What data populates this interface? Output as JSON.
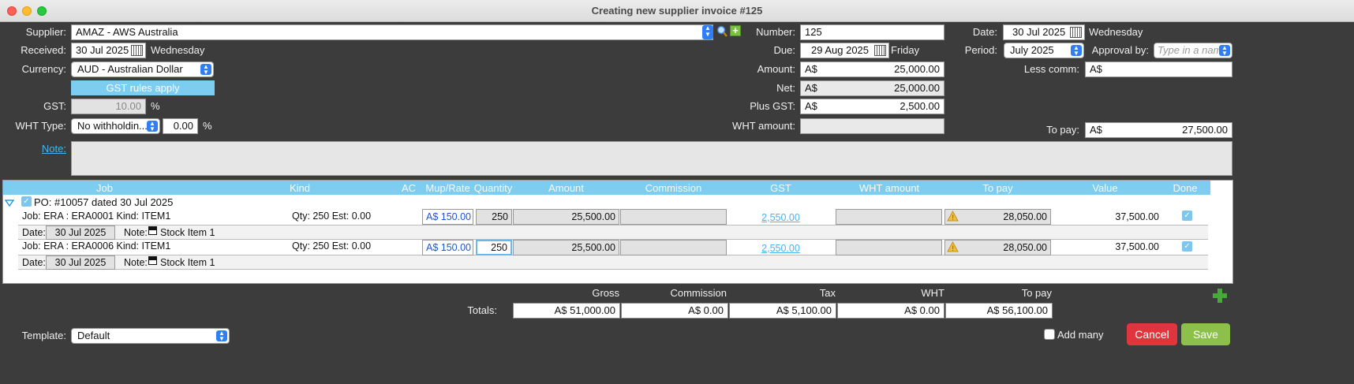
{
  "window": {
    "title": "Creating new supplier invoice #125"
  },
  "supplier": {
    "label": "Supplier:",
    "value": "AMAZ - AWS Australia"
  },
  "received": {
    "label": "Received:",
    "date": "30 Jul 2025",
    "weekday": "Wednesday"
  },
  "currency": {
    "label": "Currency:",
    "value": "AUD - Australian Dollar"
  },
  "gst_rules_button": "GST rules apply",
  "gst": {
    "label": "GST:",
    "value": "10.00",
    "unit": "%"
  },
  "wht_type": {
    "label": "WHT Type:",
    "value": "No withholdin...",
    "rate": "0.00",
    "unit": "%"
  },
  "note": {
    "label": "Note:",
    "value": ""
  },
  "number": {
    "label": "Number:",
    "value": "125"
  },
  "due": {
    "label": "Due:",
    "date": "29 Aug 2025",
    "weekday": "Friday"
  },
  "amount": {
    "label": "Amount:",
    "currency": "A$",
    "value": "25,000.00"
  },
  "net": {
    "label": "Net:",
    "currency": "A$",
    "value": "25,000.00"
  },
  "plus_gst": {
    "label": "Plus GST:",
    "currency": "A$",
    "value": "2,500.00"
  },
  "wht_amount": {
    "label": "WHT amount:",
    "value": ""
  },
  "date": {
    "label": "Date:",
    "value": "30 Jul 2025",
    "weekday": "Wednesday"
  },
  "period": {
    "label": "Period:",
    "value": "July 2025"
  },
  "approval": {
    "label": "Approval by:",
    "placeholder": "Type in a name"
  },
  "less_comm": {
    "label": "Less comm:",
    "currency": "A$",
    "value": ""
  },
  "to_pay": {
    "label": "To pay:",
    "currency": "A$",
    "value": "27,500.00"
  },
  "grid": {
    "columns": [
      "Job",
      "Kind",
      "AC",
      "Mup/Rate",
      "Quantity",
      "Amount",
      "Commission",
      "GST",
      "WHT amount",
      "To pay",
      "Value",
      "Done"
    ],
    "po_label": "PO: #10057 dated 30 Jul 2025",
    "rows": [
      {
        "job": "Job: ERA : ERA0001 Kind: ITEM1",
        "qty_est": "Qty: 250 Est: 0.00",
        "rate": "A$ 150.00",
        "quantity": "250",
        "amount": "25,500.00",
        "commission": "",
        "gst": "2,550.00",
        "wht": "",
        "to_pay": "28,050.00",
        "value": "37,500.00",
        "date_label": "Date:",
        "date": "30 Jul 2025",
        "note_label": "Note:",
        "note": "Stock Item 1"
      },
      {
        "job": "Job: ERA : ERA0006 Kind: ITEM1",
        "qty_est": "Qty: 250 Est: 0.00",
        "rate": "A$ 150.00",
        "quantity": "250",
        "amount": "25,500.00",
        "commission": "",
        "gst": "2,550.00",
        "wht": "",
        "to_pay": "28,050.00",
        "value": "37,500.00",
        "date_label": "Date:",
        "date": "30 Jul 2025",
        "note_label": "Note:",
        "note": "Stock Item 1"
      }
    ]
  },
  "totals": {
    "label": "Totals:",
    "headers": [
      "Gross",
      "Commission",
      "Tax",
      "WHT",
      "To pay"
    ],
    "values": [
      "A$ 51,000.00",
      "A$ 0.00",
      "A$ 5,100.00",
      "A$ 0.00",
      "A$ 56,100.00"
    ]
  },
  "template": {
    "label": "Template:",
    "value": "Default"
  },
  "add_many": "Add many",
  "buttons": {
    "cancel": "Cancel",
    "save": "Save"
  },
  "colors": {
    "cancel": "#e0353d",
    "save": "#8cc04a",
    "header": "#7dcdf0",
    "link": "#48b4f0"
  }
}
